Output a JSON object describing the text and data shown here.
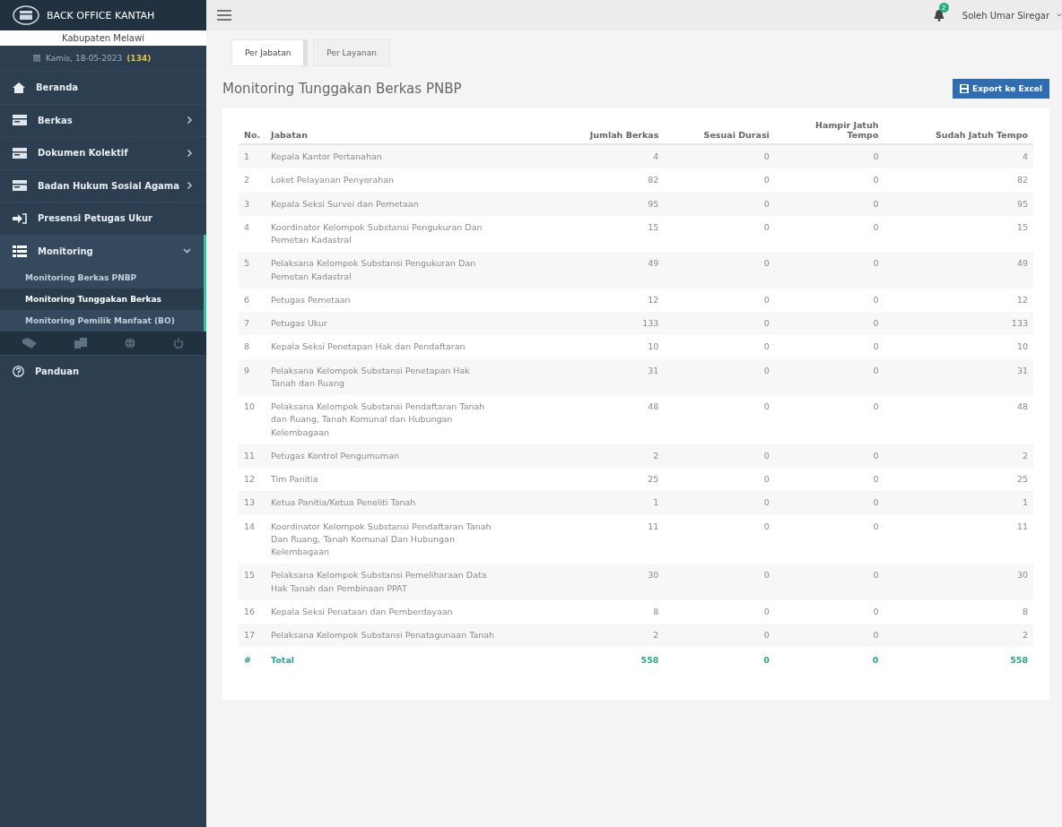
{
  "sidebar": {
    "brand": "BACK OFFICE KANTAH",
    "office": "Kabupaten Melawi",
    "date": "Kamis, 18-05-2023",
    "date_count": "(134)",
    "menu": [
      {
        "label": "Beranda",
        "kind": "home"
      },
      {
        "label": "Berkas",
        "kind": "card",
        "expanded": false
      },
      {
        "label": "Dokumen Kolektif",
        "kind": "card",
        "expanded": false
      },
      {
        "label": "Badan Hukum Sosial Agama",
        "kind": "card",
        "expanded": false
      },
      {
        "label": "Presensi Petugas Ukur",
        "kind": "signin"
      },
      {
        "label": "Monitoring",
        "kind": "list",
        "expanded": true,
        "children": [
          {
            "label": "Monitoring Berkas PNBP",
            "selected": false
          },
          {
            "label": "Monitoring Tunggakan Berkas",
            "selected": true
          },
          {
            "label": "Monitoring Pemilik Manfaat (BO)",
            "selected": false
          }
        ]
      }
    ],
    "bottom_menu": [
      {
        "label": "Panduan",
        "kind": "help"
      }
    ]
  },
  "header": {
    "notification_count": "2",
    "user": "Soleh Umar Siregar"
  },
  "tabs": [
    {
      "label": "Per Jabatan",
      "selected": true
    },
    {
      "label": "Per Layanan",
      "selected": false
    }
  ],
  "panel": {
    "title": "Monitoring Tunggakan Berkas PNBP",
    "export_button": "Export ke Excel"
  },
  "table": {
    "columns": [
      "No.",
      "Jabatan",
      "Jumlah Berkas",
      "Sesuai Durasi",
      "Hampir Jatuh Tempo",
      "Sudah Jatuh Tempo"
    ],
    "rows": [
      [
        "1",
        "Kepala Kantor Pertanahan",
        "4",
        "0",
        "0",
        "4"
      ],
      [
        "2",
        "Loket Pelayanan Penyerahan",
        "82",
        "0",
        "0",
        "82"
      ],
      [
        "3",
        "Kepala Seksi Survei dan Pemetaan",
        "95",
        "0",
        "0",
        "95"
      ],
      [
        "4",
        "Koordinator Kelompok Substansi Pengukuran Dan Pemetan Kadastral",
        "15",
        "0",
        "0",
        "15"
      ],
      [
        "5",
        "Pelaksana Kelompok Substansi Pengukuran Dan Pemetan Kadastral",
        "49",
        "0",
        "0",
        "49"
      ],
      [
        "6",
        "Petugas Pemetaan",
        "12",
        "0",
        "0",
        "12"
      ],
      [
        "7",
        "Petugas Ukur",
        "133",
        "0",
        "0",
        "133"
      ],
      [
        "8",
        "Kepala Seksi Penetapan Hak dan Pendaftaran",
        "10",
        "0",
        "0",
        "10"
      ],
      [
        "9",
        "Pelaksana Kelompok Substansi Penetapan Hak Tanah dan Ruang",
        "31",
        "0",
        "0",
        "31"
      ],
      [
        "10",
        "Pelaksana Kelompok Substansi Pendaftaran Tanah dan Ruang, Tanah Komunal dan Hubungan Kelembagaan",
        "48",
        "0",
        "0",
        "48"
      ],
      [
        "11",
        "Petugas Kontrol Pengumuman",
        "2",
        "0",
        "0",
        "2"
      ],
      [
        "12",
        "Tim Panitia",
        "25",
        "0",
        "0",
        "25"
      ],
      [
        "13",
        "Ketua Panitia/Ketua Peneliti Tanah",
        "1",
        "0",
        "0",
        "1"
      ],
      [
        "14",
        "Koordinator Kelompok Substansi Pendaftaran Tanah Dan Ruang, Tanah Komunal Dan Hubungan Kelembagaan",
        "11",
        "0",
        "0",
        "11"
      ],
      [
        "15",
        "Pelaksana Kelompok Substansi Pemeliharaan Data Hak Tanah dan Pembinaan PPAT",
        "30",
        "0",
        "0",
        "30"
      ],
      [
        "16",
        "Kepala Seksi Penataan dan Pemberdayaan",
        "8",
        "0",
        "0",
        "8"
      ],
      [
        "17",
        "Pelaksana Kelompok Substansi Penatagunaan Tanah",
        "2",
        "0",
        "0",
        "2"
      ]
    ],
    "total": [
      "#",
      "Total",
      "558",
      "0",
      "0",
      "558"
    ]
  }
}
